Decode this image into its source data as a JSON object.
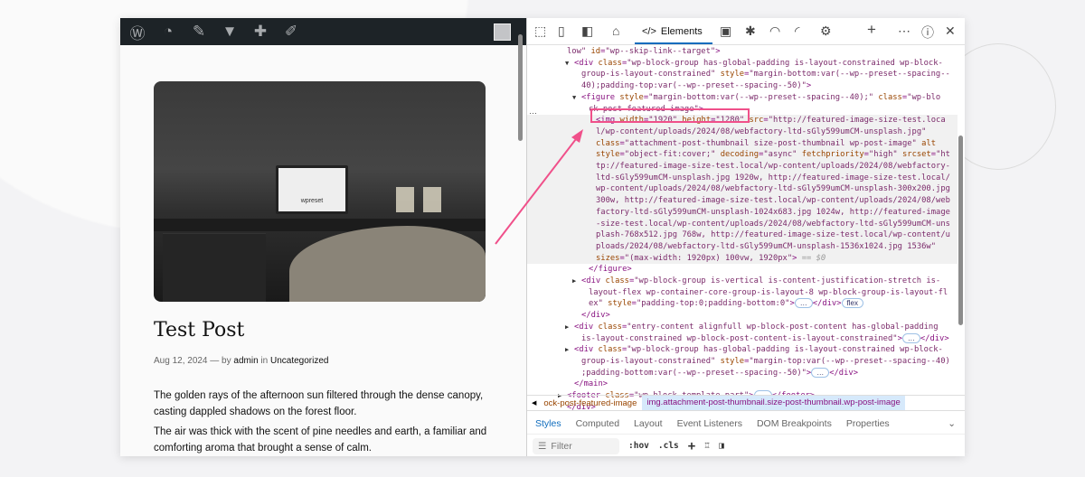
{
  "browser_page": {
    "admin_bar_icons": [
      "wordpress-icon",
      "dashboard-icon",
      "customize-icon",
      "comments-icon",
      "new-icon",
      "edit-icon"
    ],
    "post_title": "Test Post",
    "meta": {
      "date": "Aug 12, 2024",
      "sep": " — by ",
      "author": "admin",
      "in": " in ",
      "category": "Uncategorized"
    },
    "paragraphs": [
      "The golden rays of the afternoon sun filtered through the dense canopy, casting dappled shadows on the forest floor.",
      "The air was thick with the scent of pine needles and earth, a familiar and comforting aroma that brought a sense of calm."
    ],
    "image_text": "wpreset"
  },
  "devtools": {
    "toolbar": {
      "elements_tab": "Elements",
      "elements_glyph": "</>"
    },
    "code_lines": [
      {
        "d": 0,
        "s": [
          [
            "val",
            "low\""
          ],
          [
            "attr",
            " id"
          ],
          [
            "tag",
            "="
          ],
          [
            "val",
            "\"wp--skip-link--target\""
          ],
          [
            "tag",
            ">"
          ]
        ]
      },
      {
        "d": 1,
        "a": "▼",
        "s": [
          [
            "tag",
            "<div "
          ],
          [
            "attr",
            "class"
          ],
          [
            "tag",
            "="
          ],
          [
            "val",
            "\"wp-block-group has-global-padding is-layout-constrained wp-block-"
          ]
        ]
      },
      {
        "d": 2,
        "s": [
          [
            "val",
            "group-is-layout-constrained\""
          ],
          [
            "attr",
            " style"
          ],
          [
            "tag",
            "="
          ],
          [
            "val",
            "\"margin-bottom:var(--wp--preset--spacing--"
          ]
        ]
      },
      {
        "d": 2,
        "s": [
          [
            "val",
            "40);padding-top:var(--wp--preset--spacing--50)\""
          ],
          [
            "tag",
            ">"
          ]
        ]
      },
      {
        "d": 2,
        "a": "▼",
        "s": [
          [
            "tag",
            "<figure "
          ],
          [
            "attr",
            "style"
          ],
          [
            "tag",
            "="
          ],
          [
            "val",
            "\"margin-bottom:var(--wp--preset--spacing--40);\""
          ],
          [
            "attr",
            " class"
          ],
          [
            "tag",
            "="
          ],
          [
            "val",
            "\"wp-blo"
          ]
        ]
      },
      {
        "d": 3,
        "s": [
          [
            "val",
            "ck-post-featured-image\""
          ],
          [
            "tag",
            ">"
          ]
        ]
      },
      {
        "d": 4,
        "sel": 1,
        "s": [
          [
            "tag",
            "<img "
          ],
          [
            "attr",
            "width"
          ],
          [
            "tag",
            "="
          ],
          [
            "val",
            "\"1920\""
          ],
          [
            "attr",
            " height"
          ],
          [
            "tag",
            "="
          ],
          [
            "val",
            "\"1280\""
          ],
          [
            "attr",
            " src"
          ],
          [
            "tag",
            "="
          ],
          [
            "val",
            "\"http://featured-image-size-test.loca"
          ]
        ]
      },
      {
        "d": 4,
        "sel": 1,
        "s": [
          [
            "val",
            "l/wp-content/uploads/2024/08/webfactory-ltd-sGly599umCM-unsplash.jpg\""
          ]
        ]
      },
      {
        "d": 4,
        "sel": 1,
        "s": [
          [
            "attr",
            "class"
          ],
          [
            "tag",
            "="
          ],
          [
            "val",
            "\"attachment-post-thumbnail size-post-thumbnail wp-post-image\""
          ],
          [
            "attr",
            " alt"
          ]
        ]
      },
      {
        "d": 4,
        "sel": 1,
        "s": [
          [
            "attr",
            "style"
          ],
          [
            "tag",
            "="
          ],
          [
            "val",
            "\"object-fit:cover;\""
          ],
          [
            "attr",
            " decoding"
          ],
          [
            "tag",
            "="
          ],
          [
            "val",
            "\"async\""
          ],
          [
            "attr",
            " fetchpriority"
          ],
          [
            "tag",
            "="
          ],
          [
            "val",
            "\"high\""
          ],
          [
            "attr",
            " srcset"
          ],
          [
            "tag",
            "="
          ],
          [
            "val",
            "\"ht"
          ]
        ]
      },
      {
        "d": 4,
        "sel": 1,
        "s": [
          [
            "val",
            "tp://featured-image-size-test.local/wp-content/uploads/2024/08/webfactory-"
          ]
        ]
      },
      {
        "d": 4,
        "sel": 1,
        "s": [
          [
            "val",
            "ltd-sGly599umCM-unsplash.jpg 1920w, http://featured-image-size-test.local/"
          ]
        ]
      },
      {
        "d": 4,
        "sel": 1,
        "s": [
          [
            "val",
            "wp-content/uploads/2024/08/webfactory-ltd-sGly599umCM-unsplash-300x200.jpg"
          ]
        ]
      },
      {
        "d": 4,
        "sel": 1,
        "s": [
          [
            "val",
            "300w, http://featured-image-size-test.local/wp-content/uploads/2024/08/web"
          ]
        ]
      },
      {
        "d": 4,
        "sel": 1,
        "s": [
          [
            "val",
            "factory-ltd-sGly599umCM-unsplash-1024x683.jpg 1024w, http://featured-image"
          ]
        ]
      },
      {
        "d": 4,
        "sel": 1,
        "s": [
          [
            "val",
            "-size-test.local/wp-content/uploads/2024/08/webfactory-ltd-sGly599umCM-uns"
          ]
        ]
      },
      {
        "d": 4,
        "sel": 1,
        "s": [
          [
            "val",
            "plash-768x512.jpg 768w, http://featured-image-size-test.local/wp-content/u"
          ]
        ]
      },
      {
        "d": 4,
        "sel": 1,
        "s": [
          [
            "val",
            "ploads/2024/08/webfactory-ltd-sGly599umCM-unsplash-1536x1024.jpg 1536w\""
          ]
        ]
      },
      {
        "d": 4,
        "sel": 1,
        "s": [
          [
            "attr",
            "sizes"
          ],
          [
            "tag",
            "="
          ],
          [
            "val",
            "\"(max-width: 1920px) 100vw, 1920px\""
          ],
          [
            "tag",
            ">"
          ],
          [
            "dim",
            " == $0"
          ]
        ]
      },
      {
        "d": 3,
        "s": [
          [
            "tag",
            "</figure>"
          ]
        ]
      },
      {
        "d": 2,
        "a": "▶",
        "s": [
          [
            "tag",
            "<div "
          ],
          [
            "attr",
            "class"
          ],
          [
            "tag",
            "="
          ],
          [
            "val",
            "\"wp-block-group is-vertical is-content-justification-stretch is-"
          ]
        ]
      },
      {
        "d": 3,
        "s": [
          [
            "val",
            "layout-flex wp-container-core-group-is-layout-8 wp-block-group-is-layout-fl"
          ]
        ]
      },
      {
        "d": 3,
        "s": [
          [
            "val",
            "ex\""
          ],
          [
            "attr",
            " style"
          ],
          [
            "tag",
            "="
          ],
          [
            "val",
            "\"padding-top:0;padding-bottom:0\""
          ],
          [
            "tag",
            ">"
          ],
          [
            "pill",
            "…"
          ],
          [
            "tag",
            "</div>"
          ],
          [
            "pill",
            "flex"
          ]
        ]
      },
      {
        "d": 2,
        "s": [
          [
            "tag",
            "</div>"
          ]
        ]
      },
      {
        "d": 1,
        "a": "▶",
        "s": [
          [
            "tag",
            "<div "
          ],
          [
            "attr",
            "class"
          ],
          [
            "tag",
            "="
          ],
          [
            "val",
            "\"entry-content alignfull wp-block-post-content has-global-padding"
          ]
        ]
      },
      {
        "d": 2,
        "s": [
          [
            "val",
            "is-layout-constrained wp-block-post-content-is-layout-constrained\""
          ],
          [
            "tag",
            ">"
          ],
          [
            "pill",
            "…"
          ],
          [
            "tag",
            "</div>"
          ]
        ]
      },
      {
        "d": 1,
        "a": "▶",
        "s": [
          [
            "tag",
            "<div "
          ],
          [
            "attr",
            "class"
          ],
          [
            "tag",
            "="
          ],
          [
            "val",
            "\"wp-block-group has-global-padding is-layout-constrained wp-block-"
          ]
        ]
      },
      {
        "d": 2,
        "s": [
          [
            "val",
            "group-is-layout-constrained\""
          ],
          [
            "attr",
            " style"
          ],
          [
            "tag",
            "="
          ],
          [
            "val",
            "\"margin-top:var(--wp--preset--spacing--40)"
          ]
        ]
      },
      {
        "d": 2,
        "s": [
          [
            "val",
            ";padding-bottom:var(--wp--preset--spacing--50)\""
          ],
          [
            "tag",
            ">"
          ],
          [
            "pill",
            "…"
          ],
          [
            "tag",
            "</div>"
          ]
        ]
      },
      {
        "d": 1,
        "s": [
          [
            "tag",
            "</main>"
          ]
        ]
      },
      {
        "d": 0,
        "a": "▶",
        "s": [
          [
            "tag",
            "<footer "
          ],
          [
            "attr",
            "class"
          ],
          [
            "tag",
            "="
          ],
          [
            "val",
            "\"wp-block-template-part\""
          ],
          [
            "tag",
            ">"
          ],
          [
            "pill",
            "…"
          ],
          [
            "tag",
            "</footer>"
          ]
        ]
      },
      {
        "d": 0,
        "s": [
          [
            "tag",
            "</div>"
          ]
        ]
      }
    ],
    "breadcrumbs": [
      "ock-post-featured-image",
      "img.attachment-post-thumbnail.size-post-thumbnail.wp-post-image"
    ],
    "styles_tabs": [
      "Styles",
      "Computed",
      "Layout",
      "Event Listeners",
      "DOM Breakpoints",
      "Properties"
    ],
    "filter": {
      "placeholder": "Filter",
      "hov": ":hov",
      "cls": ".cls"
    }
  },
  "colors": {
    "highlight": "#f0508a",
    "accent": "#0f6cbd"
  }
}
